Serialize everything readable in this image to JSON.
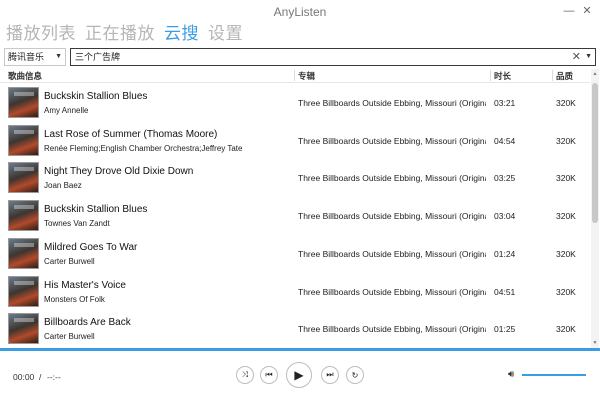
{
  "app": {
    "title": "AnyListen"
  },
  "window": {
    "minimize_icon": "minimize-icon",
    "close_icon": "close-icon"
  },
  "tabs": [
    {
      "label": "播放列表",
      "active": false
    },
    {
      "label": "正在播放",
      "active": false
    },
    {
      "label": "云搜",
      "active": true
    },
    {
      "label": "设置",
      "active": false
    }
  ],
  "search": {
    "source_selected": "腾讯音乐",
    "query": "三个广告牌"
  },
  "table": {
    "columns": [
      "歌曲信息",
      "专辑",
      "时长",
      "品质"
    ],
    "rows": [
      {
        "title": "Buckskin Stallion Blues",
        "artist": "Amy Annelle",
        "album": "Three Billboards Outside Ebbing, Missouri (Original",
        "duration": "03:21",
        "quality": "320K"
      },
      {
        "title": "Last Rose of Summer (Thomas Moore)",
        "artist": "Renée Fleming;English Chamber Orchestra;Jeffrey Tate",
        "album": "Three Billboards Outside Ebbing, Missouri (Original",
        "duration": "04:54",
        "quality": "320K"
      },
      {
        "title": "Night They Drove Old Dixie Down",
        "artist": "Joan Baez",
        "album": "Three Billboards Outside Ebbing, Missouri (Original",
        "duration": "03:25",
        "quality": "320K"
      },
      {
        "title": "Buckskin Stallion Blues",
        "artist": "Townes Van Zandt",
        "album": "Three Billboards Outside Ebbing, Missouri (Original",
        "duration": "03:04",
        "quality": "320K"
      },
      {
        "title": "Mildred Goes To War",
        "artist": "Carter Burwell",
        "album": "Three Billboards Outside Ebbing, Missouri (Original",
        "duration": "01:24",
        "quality": "320K"
      },
      {
        "title": "His Master's Voice",
        "artist": "Monsters Of Folk",
        "album": "Three Billboards Outside Ebbing, Missouri (Original",
        "duration": "04:51",
        "quality": "320K"
      },
      {
        "title": "Billboards Are Back",
        "artist": "Carter Burwell",
        "album": "Three Billboards Outside Ebbing, Missouri (Original",
        "duration": "01:25",
        "quality": "320K"
      }
    ]
  },
  "player": {
    "current_time": "00:00",
    "separator": "/",
    "total_time": "--:--",
    "controls": [
      "shuffle-icon",
      "previous-icon",
      "play-icon",
      "next-icon",
      "repeat-icon"
    ],
    "volume_icon": "volume-icon",
    "accent": "#3a9de3"
  }
}
